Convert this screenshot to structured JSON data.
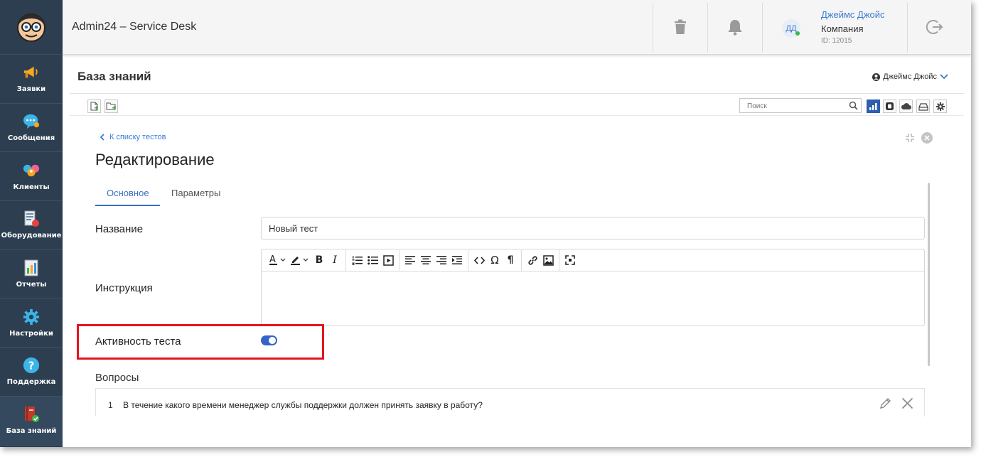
{
  "app": {
    "title": "Admin24 – Service Desk"
  },
  "user": {
    "initials": "ДД",
    "name": "Джеймс Джойс",
    "company": "Компания",
    "id_text": "ID: 12015"
  },
  "sidebar": {
    "items": [
      {
        "label": "Заявки",
        "icon": "megaphone-icon"
      },
      {
        "label": "Сообщения",
        "icon": "chat-icon"
      },
      {
        "label": "Клиенты",
        "icon": "clients-icon"
      },
      {
        "label": "Оборудование",
        "icon": "equipment-icon"
      },
      {
        "label": "Отчеты",
        "icon": "reports-icon"
      },
      {
        "label": "Настройки",
        "icon": "gear-icon"
      },
      {
        "label": "Поддержка",
        "icon": "help-icon"
      },
      {
        "label": "База знаний",
        "icon": "knowledge-base-icon"
      }
    ],
    "active_index": 7
  },
  "topbar_icons": [
    "trash-icon",
    "bell-icon",
    "logout-icon"
  ],
  "page": {
    "title": "База знаний",
    "user_menu_label": "Джеймс Джойс"
  },
  "search": {
    "placeholder": "Поиск",
    "value": ""
  },
  "editor": {
    "back_label": "К списку тестов",
    "title": "Редактирование",
    "tabs": [
      {
        "label": "Основное",
        "active": true
      },
      {
        "label": "Параметры",
        "active": false
      }
    ],
    "name_label": "Название",
    "name_value": "Новый тест",
    "instruction_label": "Инструкция",
    "instruction_value": "",
    "active_label": "Активность теста",
    "active_on": true,
    "questions_label": "Вопросы",
    "questions": [
      {
        "num": "1",
        "text": "В течение какого времени менеджер службы поддержки должен принять заявку в работу?"
      }
    ]
  },
  "colors": {
    "sidebar": "#2d3e50",
    "accent": "#3a6fc5",
    "highlight": "#e8141b",
    "link": "#3a7bd5"
  }
}
